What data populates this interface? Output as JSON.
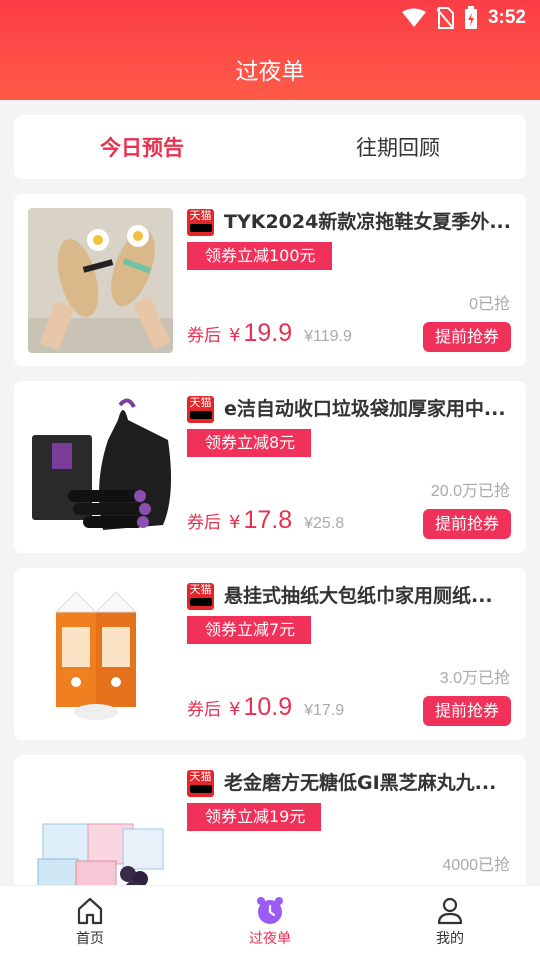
{
  "status": {
    "time": "3:52"
  },
  "header": {
    "title": "过夜单"
  },
  "tabs": [
    {
      "label": "今日预告",
      "active": true
    },
    {
      "label": "往期回顾",
      "active": false
    }
  ],
  "items": [
    {
      "platform": "天猫",
      "title": "TYK2024新款凉拖鞋女夏季外...",
      "coupon": "领券立减100元",
      "sold": "0已抢",
      "after_label": "券后",
      "currency": "¥",
      "price": "19.9",
      "original": "¥119.9",
      "button": "提前抢券",
      "image": "sandals-photo"
    },
    {
      "platform": "天猫",
      "title": "e洁自动收口垃圾袋加厚家用中...",
      "coupon": "领券立减8元",
      "sold": "20.0万已抢",
      "after_label": "券后",
      "currency": "¥",
      "price": "17.8",
      "original": "¥25.8",
      "button": "提前抢券",
      "image": "garbage-bags-photo"
    },
    {
      "platform": "天猫",
      "title": "悬挂式抽纸大包纸巾家用厕纸...",
      "coupon": "领券立减7元",
      "sold": "3.0万已抢",
      "after_label": "券后",
      "currency": "¥",
      "price": "10.9",
      "original": "¥17.9",
      "button": "提前抢券",
      "image": "tissue-photo"
    },
    {
      "platform": "天猫",
      "title": "老金磨方无糖低GI黑芝麻丸九...",
      "coupon": "领券立减19元",
      "sold": "4000已抢",
      "image": "sesame-balls-photo"
    }
  ],
  "nav": [
    {
      "label": "首页",
      "icon": "home-icon",
      "active": false
    },
    {
      "label": "过夜单",
      "icon": "alarm-clock-icon",
      "active": true
    },
    {
      "label": "我的",
      "icon": "user-icon",
      "active": false
    }
  ],
  "colors": {
    "accent": "#e9304f",
    "header": "#fb3d46",
    "coupon": "#f0315a"
  }
}
